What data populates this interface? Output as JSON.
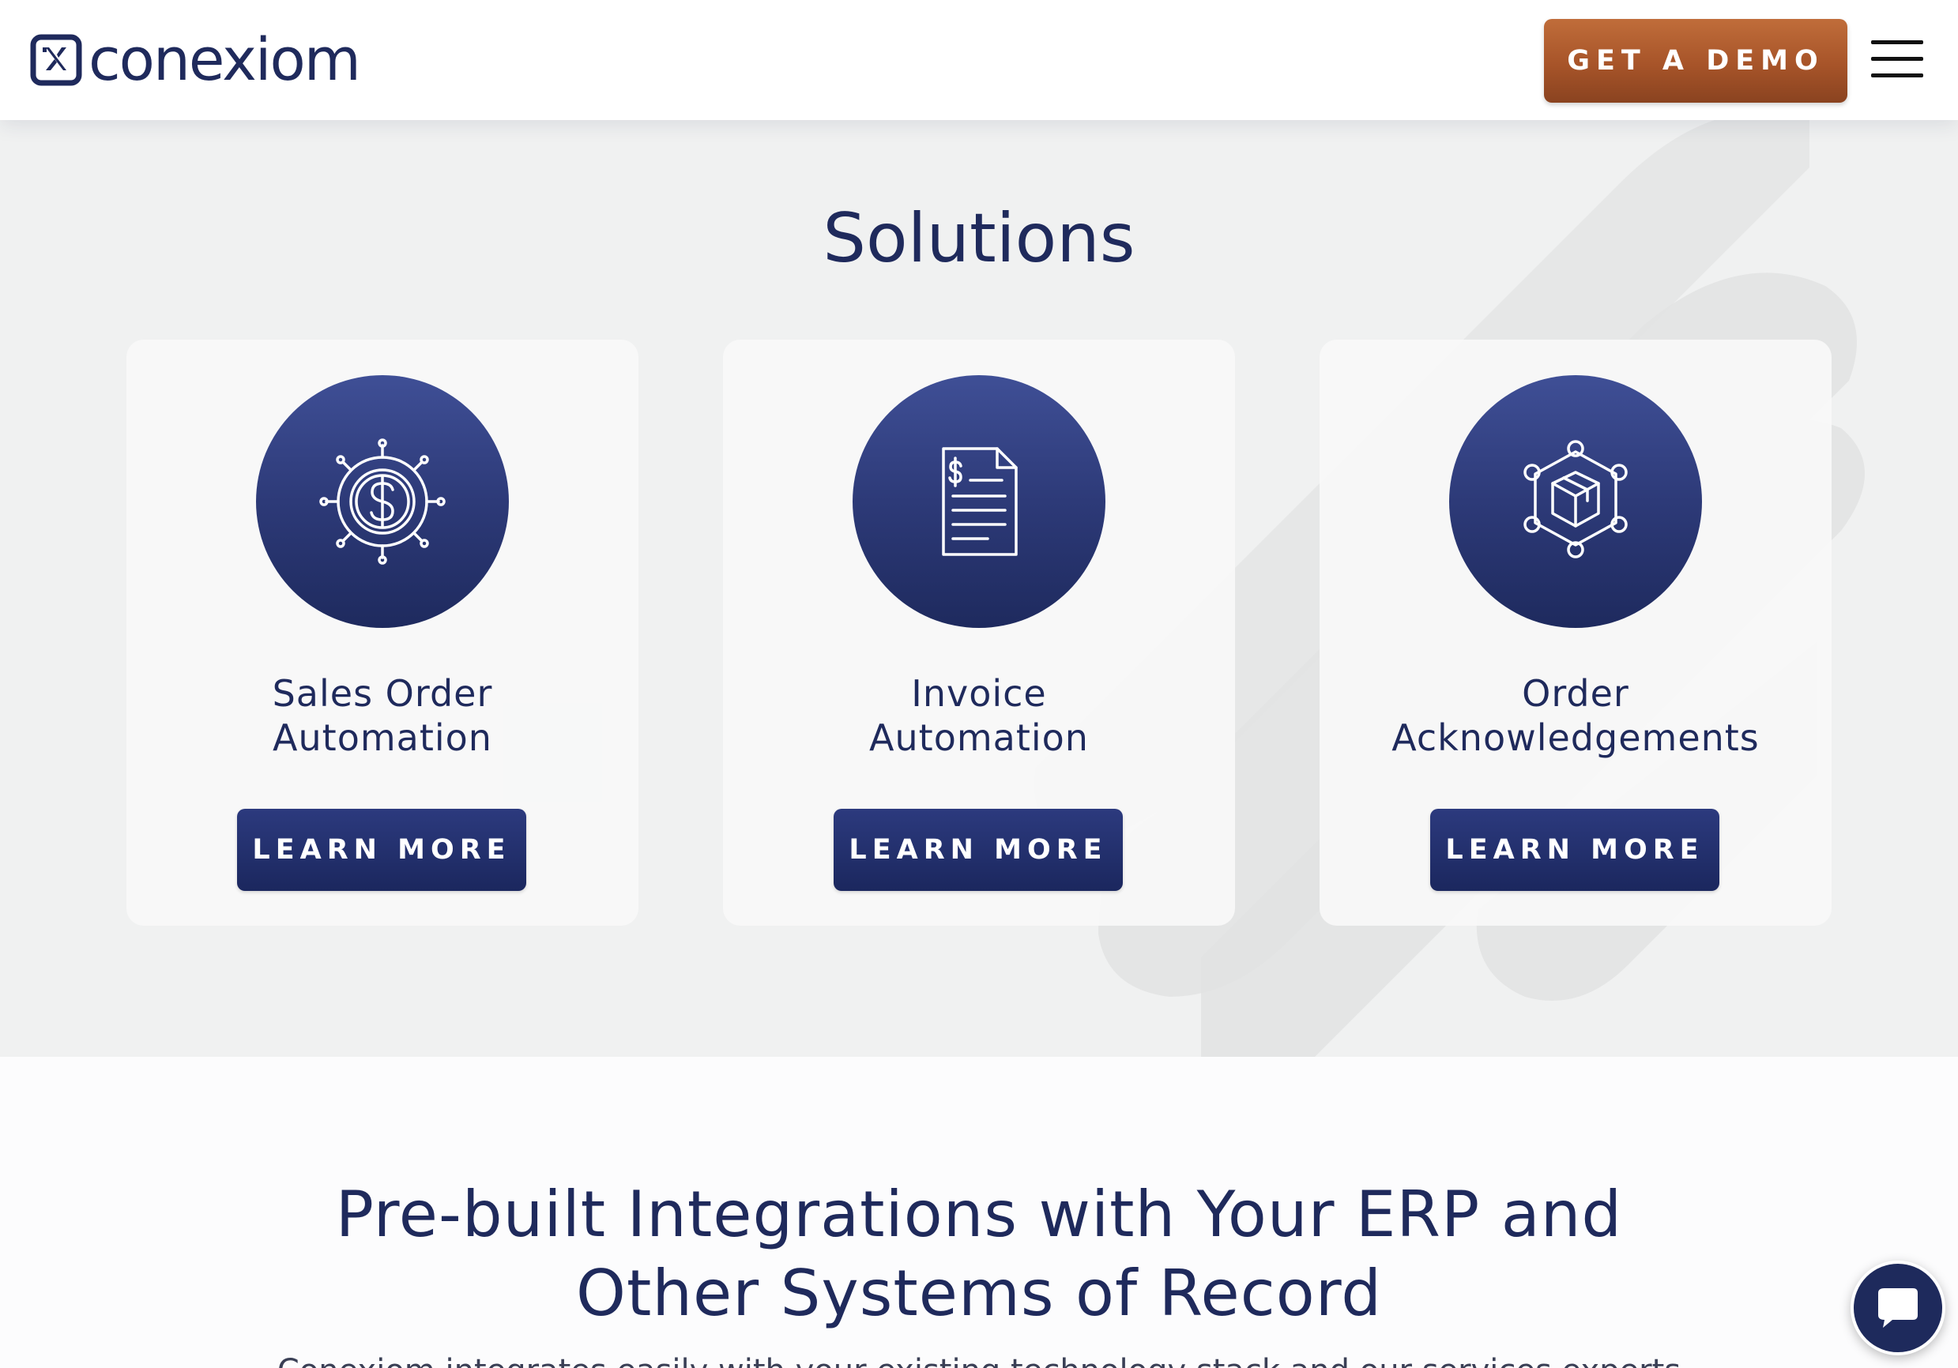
{
  "header": {
    "logo_text": "conexiom",
    "demo_label": "GET A DEMO",
    "menu_icon": "hamburger-icon"
  },
  "solutions": {
    "title": "Solutions",
    "cards": [
      {
        "title_line1": "Sales Order",
        "title_line2": "Automation",
        "icon": "gear-dollar-icon",
        "button_label": "LEARN MORE"
      },
      {
        "title_line1": "Invoice",
        "title_line2": "Automation",
        "icon": "invoice-document-icon",
        "button_label": "LEARN MORE"
      },
      {
        "title_line1": "Order",
        "title_line2": "Acknowledgements",
        "icon": "network-box-icon",
        "button_label": "LEARN MORE"
      }
    ]
  },
  "integrations": {
    "title_line1": "Pre-built Integrations with Your ERP and",
    "title_line2": "Other Systems of Record",
    "body": "Conexiom integrates easily with your existing technology stack and our services experts"
  },
  "chat": {
    "icon": "chat-bubble-icon"
  },
  "colors": {
    "navy": "#1f2a5c",
    "copper": "#a75429",
    "band": "#f0f1f1"
  }
}
